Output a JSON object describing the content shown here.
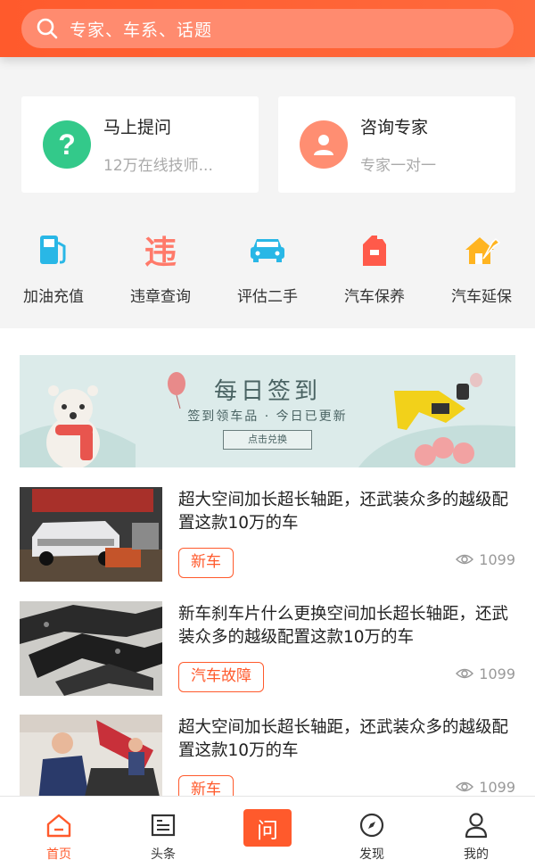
{
  "search": {
    "placeholder": "专家、车系、话题"
  },
  "cards": [
    {
      "title": "马上提问",
      "subtitle": "12万在线技师...",
      "icon": "question-icon",
      "color": "#33c98a"
    },
    {
      "title": "咨询专家",
      "subtitle": "专家一对一",
      "icon": "user-icon",
      "color": "#ff8e72"
    }
  ],
  "quick_items": [
    {
      "label": "加油充值",
      "icon": "fuel-pump-icon",
      "color": "#29b7e6"
    },
    {
      "label": "违章查询",
      "icon": "violation-icon",
      "icon_text": "违",
      "color": "#ff7a6a"
    },
    {
      "label": "评估二手",
      "icon": "car-icon",
      "color": "#29b7e6"
    },
    {
      "label": "汽车保养",
      "icon": "oil-can-icon",
      "color": "#ff5a4a"
    },
    {
      "label": "汽车延保",
      "icon": "house-wrench-icon",
      "color": "#ffb420"
    }
  ],
  "banner": {
    "title": "每日签到",
    "subtitle": "签到领车品 · 今日已更新",
    "button": "点击兑换"
  },
  "articles": [
    {
      "title": "超大空间加长超长轴距，还武装众多的越级配置这款10万的车",
      "tag": "新车",
      "views": "1099"
    },
    {
      "title": "新车刹车片什么更换空间加长超长轴距，还武装众多的越级配置这款10万的车",
      "tag": "汽车故障",
      "views": "1099"
    },
    {
      "title": "超大空间加长超长轴距，还武装众多的越级配置这款10万的车",
      "tag": "新车",
      "views": "1099"
    }
  ],
  "tabs": [
    {
      "label": "首页",
      "icon": "home-icon",
      "active": true
    },
    {
      "label": "头条",
      "icon": "news-icon",
      "active": false
    },
    {
      "label": "问",
      "icon": "ask-icon",
      "active": false
    },
    {
      "label": "发现",
      "icon": "compass-icon",
      "active": false
    },
    {
      "label": "我的",
      "icon": "person-icon",
      "active": false
    }
  ],
  "colors": {
    "brand": "#ff5a2c",
    "background": "#f4f4f4"
  }
}
